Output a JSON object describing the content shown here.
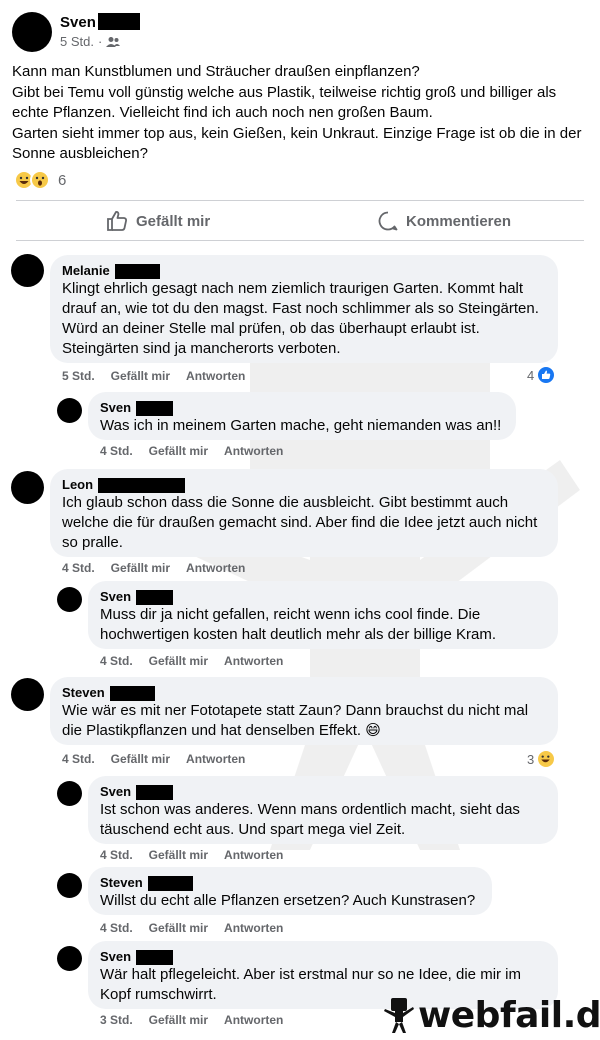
{
  "post": {
    "author": "Sven",
    "time": "5 Std.",
    "separator": "·",
    "body": "Kann man Kunstblumen und Sträucher draußen einpflanzen?\nGibt bei Temu voll günstig welche aus Plastik, teilweise richtig groß und billiger als echte Pflanzen. Vielleicht find ich auch noch nen großen Baum.\nGarten sieht immer top aus, kein Gießen, kein Unkraut. Einzige Frage ist ob die in der Sonne ausbleichen?",
    "reaction_count": "6",
    "like_label": "Gefällt mir",
    "comment_label": "Kommentieren"
  },
  "comments": [
    {
      "name": "Melanie",
      "text": "Klingt ehrlich gesagt nach nem ziemlich traurigen Garten. Kommt halt drauf an, wie tot du den magst. Fast noch schlimmer als so Steingärten. Würd an deiner Stelle mal prüfen, ob das überhaupt erlaubt ist. Steingärten sind ja mancherorts verboten.",
      "time": "5 Std.",
      "like": "Gefällt mir",
      "reply": "Antworten",
      "reactions": "4"
    },
    {
      "name": "Sven",
      "text": "Was ich in meinem Garten mache, geht niemanden was an!!",
      "time": "4 Std.",
      "like": "Gefällt mir",
      "reply": "Antworten"
    },
    {
      "name": "Leon",
      "text": "Ich glaub schon dass die Sonne die ausbleicht. Gibt bestimmt auch welche die für draußen gemacht sind. Aber find die Idee jetzt auch nicht so pralle.",
      "time": "4 Std.",
      "like": "Gefällt mir",
      "reply": "Antworten"
    },
    {
      "name": "Sven",
      "text": "Muss dir ja nicht gefallen, reicht wenn ichs cool finde. Die hochwertigen kosten halt deutlich mehr als der billige Kram.",
      "time": "4 Std.",
      "like": "Gefällt mir",
      "reply": "Antworten"
    },
    {
      "name": "Steven",
      "text": "Wie wär es mit ner Fototapete statt Zaun? Dann brauchst du nicht mal die Plastikpflanzen und hat denselben Effekt.",
      "emoji": "😄",
      "time": "4 Std.",
      "like": "Gefällt mir",
      "reply": "Antworten",
      "reactions": "3"
    },
    {
      "name": "Sven",
      "text": "Ist schon was anderes. Wenn mans ordentlich macht, sieht das täuschend echt aus. Und spart mega viel Zeit.",
      "time": "4 Std.",
      "like": "Gefällt mir",
      "reply": "Antworten"
    },
    {
      "name": "Steven",
      "text": "Willst du echt alle Pflanzen ersetzen? Auch Kunstrasen?",
      "time": "4 Std.",
      "like": "Gefällt mir",
      "reply": "Antworten"
    },
    {
      "name": "Sven",
      "text": "Wär halt pflegeleicht. Aber ist erstmal nur so ne Idee, die mir im Kopf rumschwirrt.",
      "time": "3 Std.",
      "like": "Gefällt mir",
      "reply": "Antworten"
    }
  ],
  "watermark": {
    "text": "webfail.de"
  },
  "colors": {
    "bubble": "#f0f2f5",
    "meta": "#65676b",
    "like_blue": "#1877f2",
    "emoji_yellow": "#f7c948"
  }
}
